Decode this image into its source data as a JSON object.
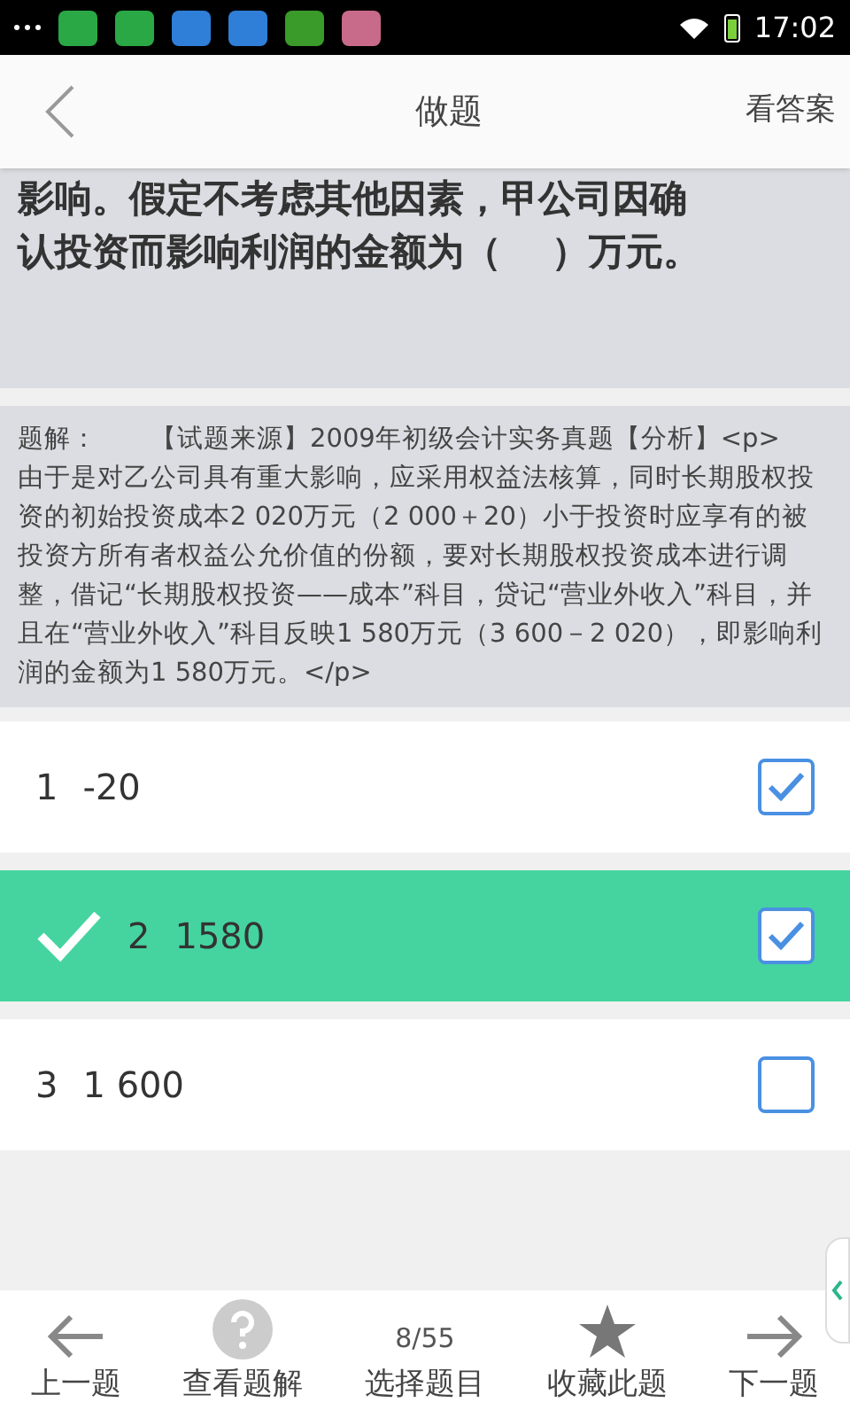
{
  "status_bar": {
    "time": "17:02"
  },
  "header": {
    "title": "做题",
    "action": "看答案"
  },
  "question": {
    "lines": [
      "影响。假定不考虑其他因素，甲公司因确",
      "认投资而影响利润的金额为（　 ）万元。"
    ]
  },
  "explanation": {
    "text": "题解：　　【试题来源】2009年初级会计实务真题【分析】<p>　　由于是对乙公司具有重大影响，应采用权益法核算，同时长期股权投资的初始投资成本2 020万元（2 000＋20）小于投资时应享有的被投资方所有者权益公允价值的份额，要对长期股权投资成本进行调整，借记“长期股权投资——成本”科目，贷记“营业外收入”科目，并且在“营业外收入”科目反映1 580万元（3 600－2 020），即影响利润的金额为1 580万元。</p>"
  },
  "options": [
    {
      "number": "1",
      "text": "-20",
      "selected": false,
      "checked": true
    },
    {
      "number": "2",
      "text": "1580",
      "selected": true,
      "checked": true
    },
    {
      "number": "3",
      "text": "1 600",
      "selected": false,
      "checked": false
    }
  ],
  "counter": "8/55",
  "bottom_nav": [
    {
      "kind": "prev",
      "label": "上一题"
    },
    {
      "kind": "help",
      "label": "查看题解"
    },
    {
      "kind": "counter",
      "label": "选择题目"
    },
    {
      "kind": "star",
      "label": "收藏此题"
    },
    {
      "kind": "next",
      "label": "下一题"
    }
  ]
}
